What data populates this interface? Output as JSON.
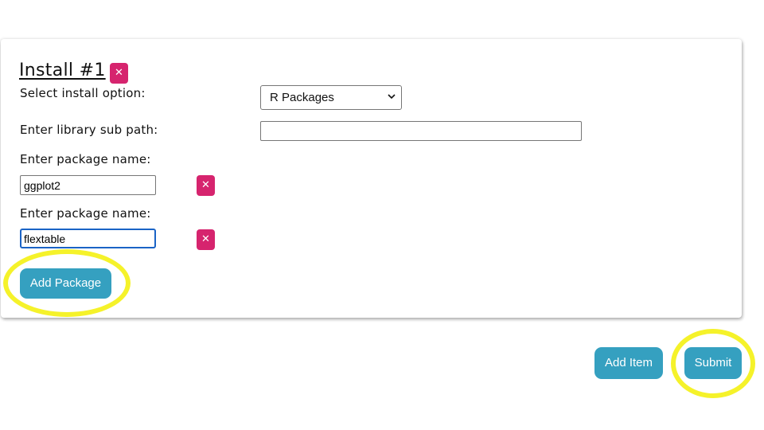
{
  "install": {
    "title": "Install #1",
    "remove_icon": "close-icon",
    "select_label": "Select install option:",
    "select_value": "R Packages",
    "library_label": "Enter library sub path:",
    "library_value": "",
    "packages": [
      {
        "label": "Enter package name:",
        "value": "ggplot2"
      },
      {
        "label": "Enter package name:",
        "value": "flextable"
      }
    ],
    "add_package_label": "Add Package"
  },
  "footer": {
    "add_item_label": "Add Item",
    "submit_label": "Submit"
  },
  "colors": {
    "accent": "#35a0c0",
    "remove": "#d6246e",
    "highlight": "#f5f22a",
    "focus": "#1a63c6"
  }
}
